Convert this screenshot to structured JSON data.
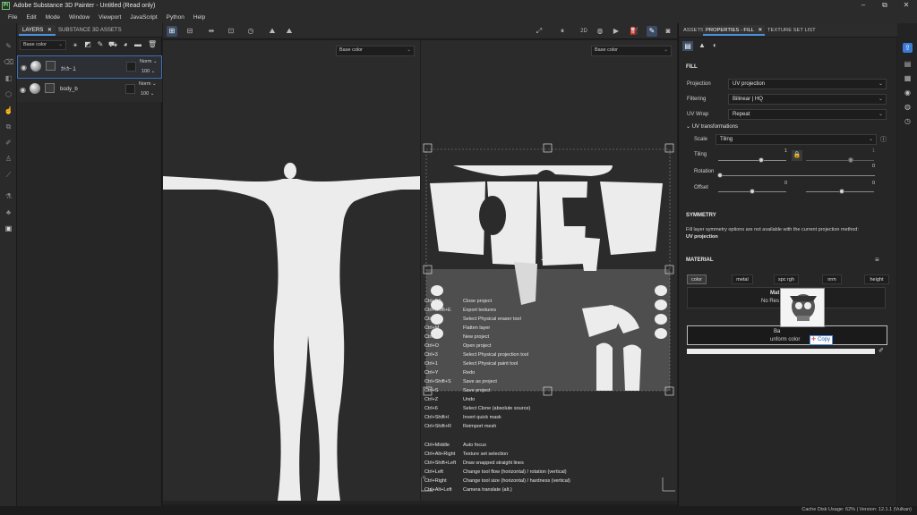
{
  "window": {
    "app_icon": "Pt",
    "title": "Adobe Substance 3D Painter - Untitled (Read only)",
    "controls": [
      "–",
      "⧉",
      "✕"
    ]
  },
  "menubar": [
    "File",
    "Edit",
    "Mode",
    "Window",
    "Viewport",
    "JavaScript",
    "Python",
    "Help"
  ],
  "layers_panel": {
    "tabs": [
      {
        "label": "LAYERS",
        "close": "✕"
      },
      {
        "label": "SUBSTANCE 3D ASSETS"
      }
    ],
    "channel_dropdown": "Base color",
    "layers": [
      {
        "name": "ｶﾄｶｰ１",
        "blend": "Norm",
        "opacity": "100",
        "selected": true
      },
      {
        "name": "body_b",
        "blend": "Norm",
        "opacity": "100",
        "selected": false
      }
    ]
  },
  "viewport": {
    "left_dropdown": "Base color",
    "right_dropdown": "Base color",
    "toolbar_icons": [
      "grid-icon",
      "grid-options-icon",
      "symmetry-icon",
      "transform-icon",
      "history-icon",
      "mountain-icon",
      "mountain-icon-2",
      "camera-mode-icon",
      "pause-icon",
      "2d-3d-icon",
      "render-icon",
      "video-icon",
      "paint-icon",
      "brush-icon",
      "screenshot-icon"
    ],
    "toolbar_labels": {
      "view_mode": "2D|3D"
    },
    "shortcuts": [
      {
        "key": "Ctrl+F4",
        "desc": "Close project"
      },
      {
        "key": "Ctrl+Shift+E",
        "desc": "Export textures"
      },
      {
        "key": "Ctrl+2",
        "desc": "Select Physical eraser tool"
      },
      {
        "key": "Ctrl+M",
        "desc": "Flatten layer"
      },
      {
        "key": "Ctrl+N",
        "desc": "New project"
      },
      {
        "key": "Ctrl+O",
        "desc": "Open project"
      },
      {
        "key": "Ctrl+3",
        "desc": "Select Physical projection tool"
      },
      {
        "key": "Ctrl+1",
        "desc": "Select Physical paint tool"
      },
      {
        "key": "Ctrl+Y",
        "desc": "Redo"
      },
      {
        "key": "Ctrl+Shift+S",
        "desc": "Save as project"
      },
      {
        "key": "Ctrl+S",
        "desc": "Save project"
      },
      {
        "key": "Ctrl+Z",
        "desc": "Undo"
      },
      {
        "key": "Ctrl+6",
        "desc": "Select Clone (absolute source)"
      },
      {
        "key": "Ctrl+Shift+I",
        "desc": "Invert quick mask"
      },
      {
        "key": "Ctrl+Shift+R",
        "desc": "Reimport mesh"
      },
      {
        "key": "",
        "desc": ""
      },
      {
        "key": "Ctrl+Middle",
        "desc": "Auto focus"
      },
      {
        "key": "Ctrl+Alt+Right",
        "desc": "Texture set selection"
      },
      {
        "key": "Ctrl+Shift+Left",
        "desc": "Draw snapped straight lines"
      },
      {
        "key": "Ctrl+Left",
        "desc": "Change tool flow (horizontal) / rotation (vertical)"
      },
      {
        "key": "Ctrl+Right",
        "desc": "Change tool size (horizontal) / hardness (vertical)"
      },
      {
        "key": "Ctrl+Alt+Left",
        "desc": "Camera translate (alt.)"
      }
    ]
  },
  "properties": {
    "tabs": [
      {
        "label": "ASSETS"
      },
      {
        "label": "PROPERTIES - FILL",
        "close": "✕"
      },
      {
        "label": "TEXTURE SET LIST"
      }
    ],
    "fill": {
      "title": "FILL",
      "projection_label": "Projection",
      "projection_value": "UV projection",
      "filtering_label": "Filtering",
      "filtering_value": "Bilinear | HQ",
      "uvwrap_label": "UV Wrap",
      "uvwrap_value": "Repeat"
    },
    "uv_transform": {
      "title": "UV transformations",
      "scale_label": "Scale",
      "scale_value": "Tiling",
      "tiling_label": "Tiling",
      "tiling_val_1": "1",
      "tiling_val_2": "1",
      "rotation_label": "Rotation",
      "rotation_val": "0",
      "offset_label": "Offset",
      "offset_val_1": "0",
      "offset_val_2": "0"
    },
    "symmetry": {
      "title": "SYMMETRY",
      "note": "Fill layer symmetry options are not available with the current projection method:",
      "method": "UV projection"
    },
    "material": {
      "title": "MATERIAL",
      "channels": [
        "color",
        "metal",
        "spc rgh",
        "nrm",
        "height"
      ],
      "mat_label": "Mat",
      "no_res": "No Res",
      "base_color_label": "Ba",
      "uniform_label": "unform color",
      "copy_label": "Copy"
    }
  },
  "statusbar": {
    "text": "Cache Disk Usage:  62% | Version: 12.1.1 (Vulkan)"
  },
  "colors": {
    "accent": "#4a8fe0",
    "panel": "#262626",
    "viewport": "#2b2b2b",
    "uv_fill": "#ececec"
  }
}
